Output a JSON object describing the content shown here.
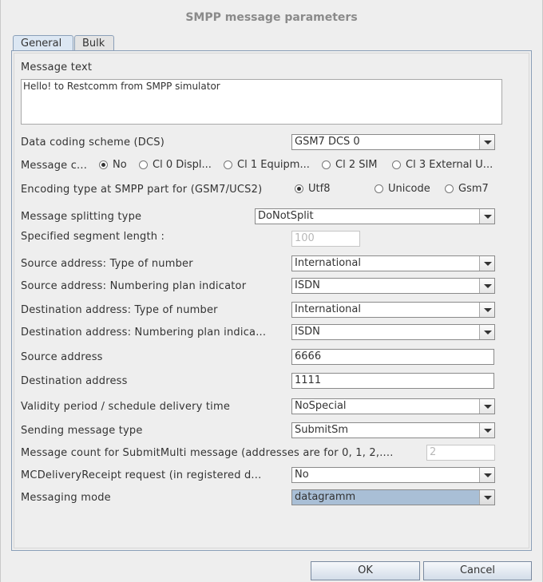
{
  "dialog": {
    "title": "SMPP message parameters"
  },
  "tabs": [
    {
      "label": "General",
      "active": true
    },
    {
      "label": "Bulk",
      "active": false
    }
  ],
  "message_text": {
    "label": "Message text",
    "value": "Hello! to Restcomm from SMPP simulator"
  },
  "dcs": {
    "label": "Data coding scheme (DCS)",
    "value": "GSM7 DCS  0"
  },
  "message_class": {
    "label": "Message c...",
    "options": [
      {
        "label": "No",
        "selected": true
      },
      {
        "label": "Cl 0 Displ...",
        "selected": false
      },
      {
        "label": "Cl 1 Equipm...",
        "selected": false
      },
      {
        "label": "Cl 2 SIM",
        "selected": false
      },
      {
        "label": "Cl 3 External U...",
        "selected": false
      }
    ]
  },
  "encoding": {
    "label": "Encoding type at SMPP part for (GSM7/UCS2)",
    "options": [
      {
        "label": "Utf8",
        "selected": true
      },
      {
        "label": "Unicode",
        "selected": false
      },
      {
        "label": "Gsm7",
        "selected": false
      }
    ]
  },
  "splitting": {
    "label": "Message splitting type",
    "value": "DoNotSplit"
  },
  "segment_length": {
    "label": "Specified segment length :",
    "value": "100"
  },
  "src_ton": {
    "label": "Source address: Type of number",
    "value": "International"
  },
  "src_npi": {
    "label": "Source address: Numbering plan indicator",
    "value": "ISDN"
  },
  "dst_ton": {
    "label": "Destination address: Type of number",
    "value": "International"
  },
  "dst_npi": {
    "label": "Destination address: Numbering plan indica...",
    "value": "ISDN"
  },
  "src_addr": {
    "label": "Source address",
    "value": "6666"
  },
  "dst_addr": {
    "label": "Destination address",
    "value": "1111"
  },
  "validity": {
    "label": "Validity period / schedule delivery time",
    "value": "NoSpecial"
  },
  "send_type": {
    "label": "Sending message type",
    "value": "SubmitSm"
  },
  "submit_multi": {
    "label": "Message count for SubmitMulti message (addresses are for 0, 1, 2,....",
    "value": "2"
  },
  "dlr": {
    "label": "MCDeliveryReceipt request (in registered  d...",
    "value": "No"
  },
  "mode": {
    "label": "Messaging mode",
    "value": "datagramm"
  },
  "buttons": {
    "ok": "OK",
    "cancel": "Cancel"
  }
}
